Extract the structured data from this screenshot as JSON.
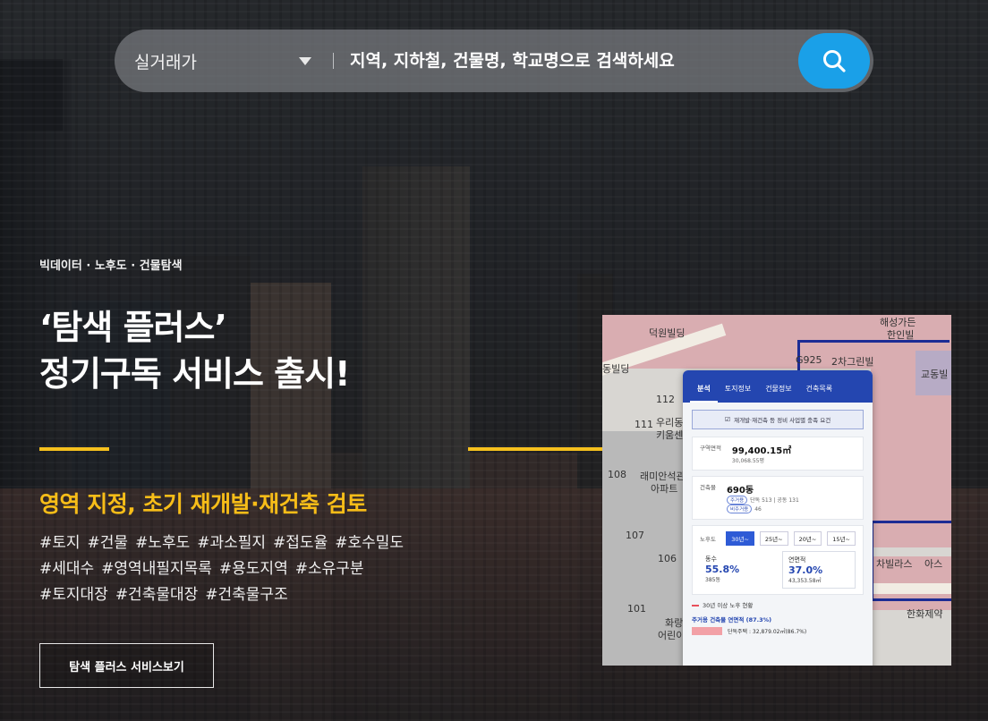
{
  "search": {
    "category": "실거래가",
    "placeholder": "지역, 지하철, 건물명, 학교명으로 검색하세요"
  },
  "hero": {
    "eyebrow": "빅데이터 · 노후도 · 건물탐색",
    "headline_line1": "‘탐색 플러스’",
    "headline_line2": "정기구독 서비스 출시!",
    "subhead": "영역 지정, 초기 재개발·재건축 검토",
    "tags_row1": [
      "#토지",
      "#건물",
      "#노후도",
      "#과소필지",
      "#접도율",
      "#호수밀도"
    ],
    "tags_row2": [
      "#세대수",
      "#영역내필지목록",
      "#용도지역",
      "#소유구분"
    ],
    "tags_row3": [
      "#토지대장",
      "#건축물대장",
      "#건축물구조"
    ],
    "cta_label": "탐색 플러스 서비스보기"
  },
  "map": {
    "labels": [
      "덕원빌딩",
      "해성가든",
      "한인빌",
      "G925",
      "2차그린빌",
      "112",
      "111",
      "우리동",
      "키움센",
      "108",
      "래미안석관",
      "아파트",
      "107",
      "106",
      "101",
      "화랑",
      "어린이",
      "한화제약",
      "교동빌",
      "아스",
      "차빌라스",
      "동빌딩"
    ]
  },
  "panel": {
    "tabs": [
      "분석",
      "토지정보",
      "건물정보",
      "건축목록"
    ],
    "notice": "재개발·재건축 등 정비 사업별 충족 요건",
    "area": {
      "label": "구역면적",
      "value": "99,400.15㎡",
      "sub": "30,068.55평"
    },
    "buildings": {
      "label": "건축물",
      "value": "690동",
      "chip1": "주거용",
      "detail1": "단독 513 | 공동 131",
      "chip2": "비주거용",
      "detail2": "46"
    },
    "age": {
      "label": "노후도",
      "options": [
        "30년~",
        "25년~",
        "20년~",
        "15년~"
      ]
    },
    "stat1": {
      "title": "동수",
      "percent": "55.8%",
      "count": "385동"
    },
    "stat2": {
      "title": "연면적",
      "percent": "37.0%",
      "count": "43,353.58㎡"
    },
    "legend": "30년 이상 노후 현황",
    "section": "주거용 건축물 연면적 (87.3%)",
    "bar_text": "단독주택 : 32,879.02㎡(86.7%)"
  }
}
